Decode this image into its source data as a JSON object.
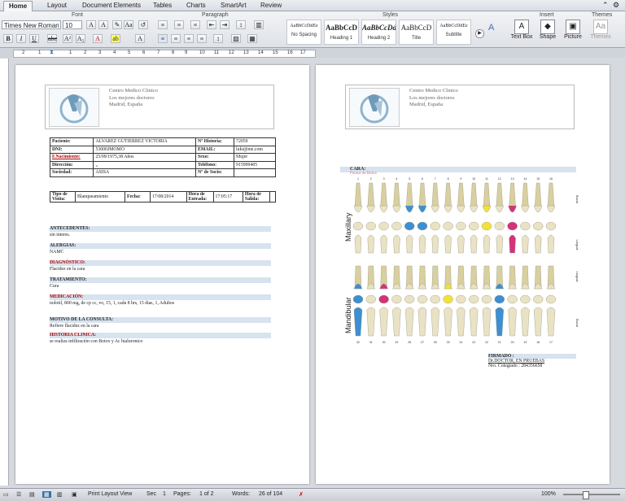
{
  "ribbon": {
    "tabs": [
      "Home",
      "Layout",
      "Document Elements",
      "Tables",
      "Charts",
      "SmartArt",
      "Review"
    ],
    "groups": {
      "font": "Font",
      "paragraph": "Paragraph",
      "styles": "Styles",
      "insert": "Insert",
      "themes": "Themes"
    },
    "font_name": "Times New Roman",
    "font_size": "10",
    "styles": [
      {
        "preview": "AaBbCcDdEe",
        "name": "No Spacing"
      },
      {
        "preview": "AaBbCcD",
        "name": "Heading 1"
      },
      {
        "preview": "AaBbCcDd",
        "name": "Heading 2"
      },
      {
        "preview": "AaBbCcD",
        "name": "Title"
      },
      {
        "preview": "AaBbCcDdEe",
        "name": "Subtitle"
      }
    ],
    "insert": [
      "Text Box",
      "Shape",
      "Picture"
    ],
    "themes": "Themes"
  },
  "ruler": [
    "2",
    "1",
    "1",
    "2",
    "3",
    "4",
    "5",
    "6",
    "7",
    "8",
    "9",
    "10",
    "11",
    "12",
    "13",
    "14",
    "15",
    "16",
    "17",
    "18"
  ],
  "doc_header": {
    "line1": "Centro Medico Clinico",
    "line2": "Los mejores doctores",
    "line3": "Madrid, España"
  },
  "patient": {
    "rows": [
      [
        "Paciente:",
        "ALVAREZ GUTIERREZ VICTORIA",
        "Nº Historia:",
        "72059"
      ],
      [
        "DNI:",
        "53000JMOMO",
        "EMAIL:",
        "luki@me.com"
      ],
      [
        "F.Nacimiento:",
        "25/09/1975,38 Años",
        "Sexo:",
        "Mujer"
      ],
      [
        "Dirección:",
        ",,",
        "Teléfono:",
        "915999405"
      ],
      [
        "Sociedad:",
        "ASISA",
        "Nº de Socio:",
        ""
      ]
    ],
    "visit": [
      "Tipo de Visita:",
      "Blanqueamiento",
      "Fecha:",
      "17/08/2014",
      "Hora de Entrada:",
      "17:05:17",
      "Hora de Salida:",
      ""
    ]
  },
  "sections": [
    {
      "title": "ANTECEDENTES:",
      "value": "sin interes."
    },
    {
      "title": "ALERGIAS:",
      "value": "NAMC"
    },
    {
      "title": "DIAGNÓSTICO:",
      "value": "Flacidez en la cara"
    },
    {
      "title": "TRATAMIENTO:",
      "value": "Cura"
    },
    {
      "title": "MEDICACIÓN:",
      "value": "nolotil, 800 mg, de cp cc, vo, 15, 1, cada 8 hrs, 15 dias, 1, Adultos"
    },
    {
      "title": "MOTIVO DE LA CONSULTA:",
      "value": "Refiere flacidez en la cara"
    },
    {
      "title": "HISTORIA CLINICA:",
      "value": "se realiza infiltración con Botox y Ac hialuronico"
    }
  ],
  "dental": {
    "title": "CARA:",
    "subtitle": "Puntos de Botox",
    "maxillary": "Maxillary",
    "mandibular": "Mandibular",
    "side_top": [
      "Bucal",
      "Lingual"
    ],
    "side_bottom": [
      "Lingual",
      "Bucal"
    ],
    "upper_numbers": [
      "1",
      "2",
      "3",
      "4",
      "5",
      "6",
      "7",
      "8",
      "9",
      "10",
      "11",
      "12",
      "13",
      "14",
      "15",
      "16"
    ],
    "lower_numbers": [
      "32",
      "31",
      "30",
      "29",
      "28",
      "27",
      "26",
      "25",
      "24",
      "23",
      "22",
      "21",
      "20",
      "19",
      "18",
      "17"
    ],
    "colors": {
      "blue": "#3d8fd1",
      "pink": "#d4327a",
      "yellow": "#f0e23a",
      "tooth": "#e9e2c4",
      "root": "#d9cf9f"
    }
  },
  "signature": {
    "title": "FIRMADO :",
    "doctor": "Dr.DOCTOR, EN PRUEBAS",
    "license": "Nro. Colegiado : 284356658"
  },
  "status": {
    "view": "Print Layout View",
    "sec_label": "Sec",
    "sec": "1",
    "pages_label": "Pages:",
    "pages": "1 of 2",
    "words_label": "Words:",
    "words": "26 of 104",
    "zoom": "100%"
  }
}
